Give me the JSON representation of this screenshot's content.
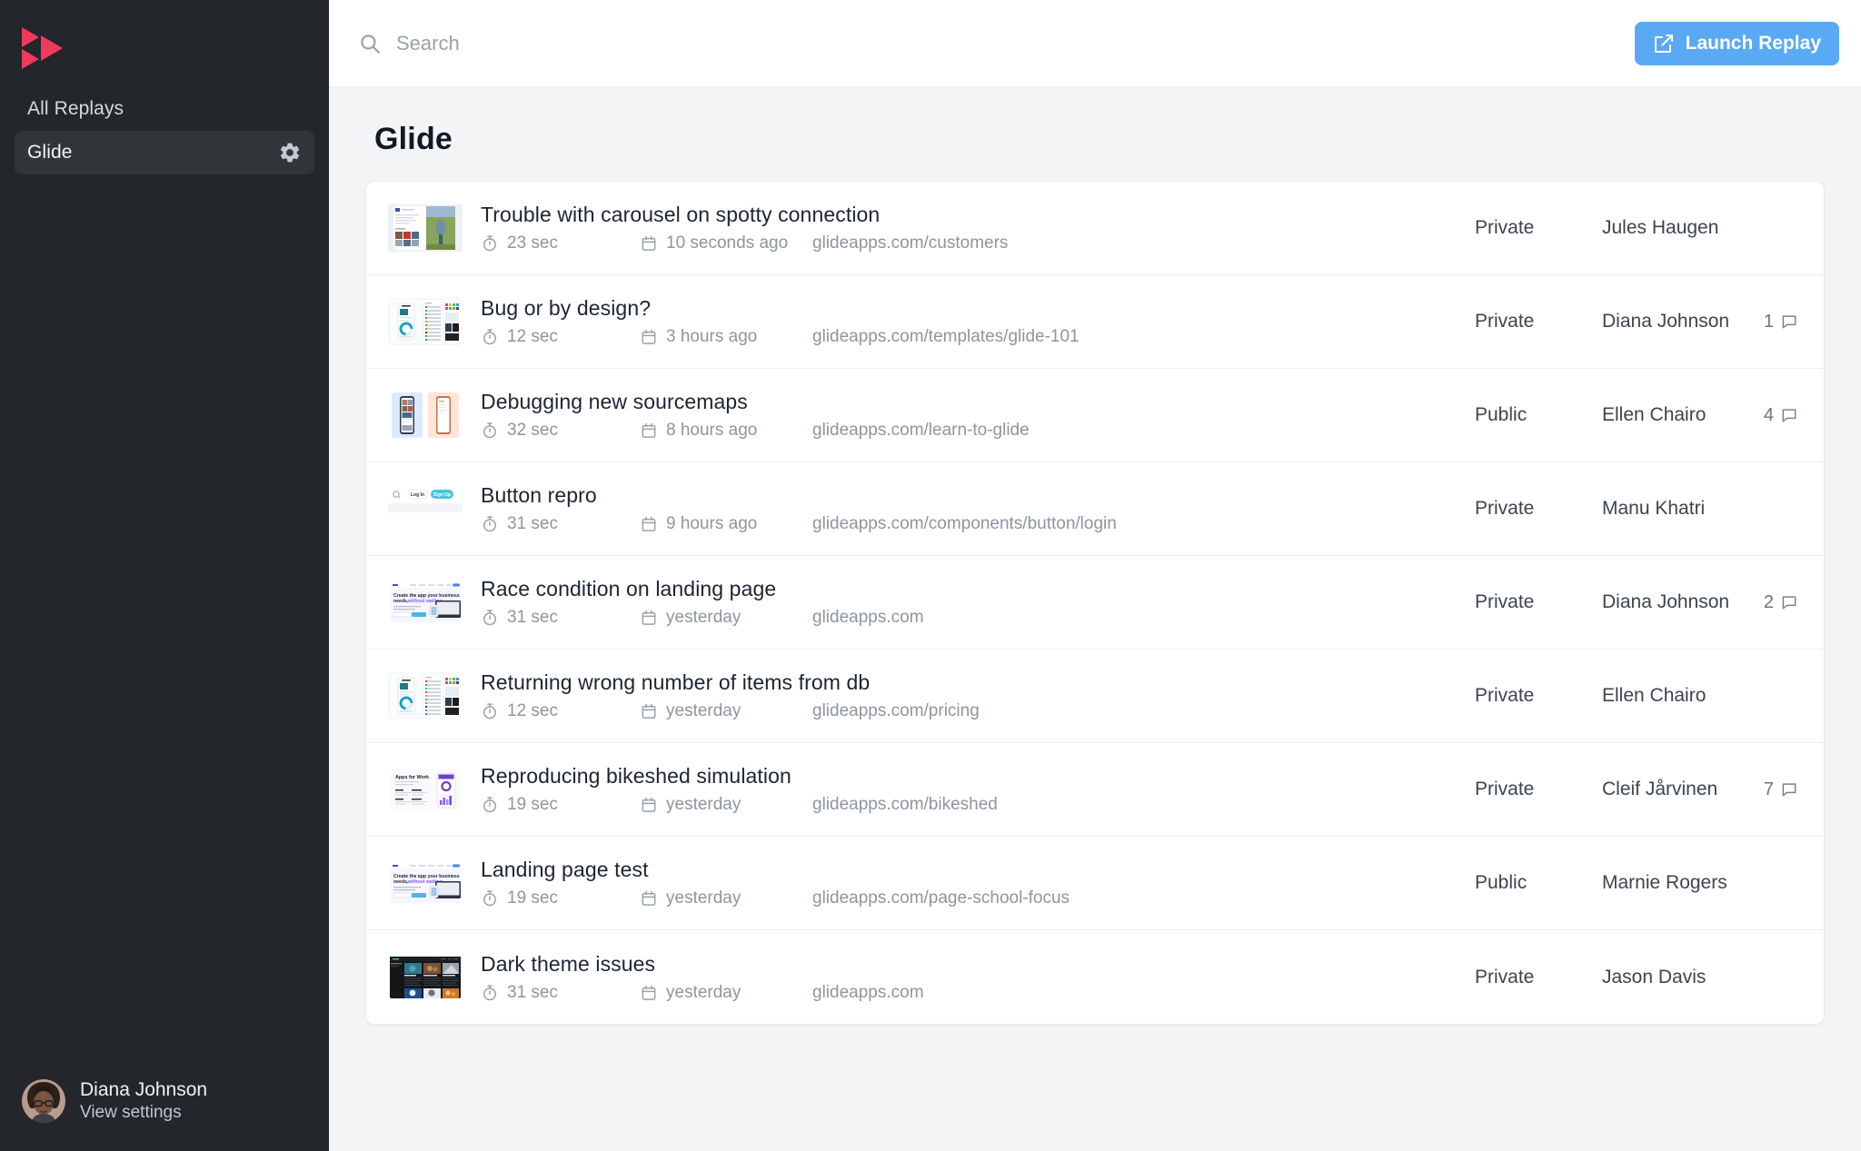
{
  "sidebar": {
    "logo_name": "replay-logo",
    "items": [
      {
        "label": "All Replays",
        "name": "sidebar-item-all-replays",
        "active": false,
        "gear": false
      },
      {
        "label": "Glide",
        "name": "sidebar-item-glide",
        "active": true,
        "gear": true
      }
    ],
    "gear_icon": "gear-icon",
    "user": {
      "name": "Diana Johnson",
      "subtitle": "View settings",
      "avatar_name": "avatar"
    }
  },
  "topbar": {
    "search_placeholder": "Search",
    "search_value": "",
    "search_icon": "search-icon",
    "launch_label": "Launch Replay",
    "launch_icon": "external-link-icon",
    "accent_color": "#5aa9f5"
  },
  "page": {
    "title": "Glide"
  },
  "icons": {
    "duration": "stopwatch-icon",
    "date": "calendar-icon",
    "comments": "comment-bubble-icon"
  },
  "replays": [
    {
      "title": "Trouble with carousel on spotty connection",
      "duration": "23 sec",
      "time": "10 seconds ago",
      "url": "glideapps.com/customers",
      "privacy": "Private",
      "author": "Jules Haugen",
      "comments": "",
      "thumb": "social-feed"
    },
    {
      "title": "Bug or by design?",
      "duration": "12 sec",
      "time": "3 hours ago",
      "url": "glideapps.com/templates/glide-101",
      "privacy": "Private",
      "author": "Diana Johnson",
      "comments": "1",
      "thumb": "templates-grid"
    },
    {
      "title": "Debugging new sourcemaps",
      "duration": "32 sec",
      "time": "8 hours ago",
      "url": "glideapps.com/learn-to-glide",
      "privacy": "Public",
      "author": "Ellen Chairo",
      "comments": "4",
      "thumb": "two-phones"
    },
    {
      "title": "Button repro",
      "duration": "31 sec",
      "time": "9 hours ago",
      "url": "glideapps.com/components/button/login",
      "privacy": "Private",
      "author": "Manu Khatri",
      "comments": "",
      "thumb": "login-header"
    },
    {
      "title": "Race condition on landing page",
      "duration": "31 sec",
      "time": "yesterday",
      "url": "glideapps.com",
      "privacy": "Private",
      "author": "Diana Johnson",
      "comments": "2",
      "thumb": "landing-hero"
    },
    {
      "title": "Returning wrong number of items from db",
      "duration": "12 sec",
      "time": "yesterday",
      "url": "glideapps.com/pricing",
      "privacy": "Private",
      "author": "Ellen Chairo",
      "comments": "",
      "thumb": "templates-grid"
    },
    {
      "title": "Reproducing bikeshed simulation",
      "duration": "19 sec",
      "time": "yesterday",
      "url": "glideapps.com/bikeshed",
      "privacy": "Private",
      "author": "Cleif Jårvinen",
      "comments": "7",
      "thumb": "apps-for-work"
    },
    {
      "title": "Landing page test",
      "duration": "19 sec",
      "time": "yesterday",
      "url": "glideapps.com/page-school-focus",
      "privacy": "Public",
      "author": "Marnie Rogers",
      "comments": "",
      "thumb": "landing-hero"
    },
    {
      "title": "Dark theme issues",
      "duration": "31 sec",
      "time": "yesterday",
      "url": "glideapps.com",
      "privacy": "Private",
      "author": "Jason Davis",
      "comments": "",
      "thumb": "dark-cards"
    }
  ]
}
